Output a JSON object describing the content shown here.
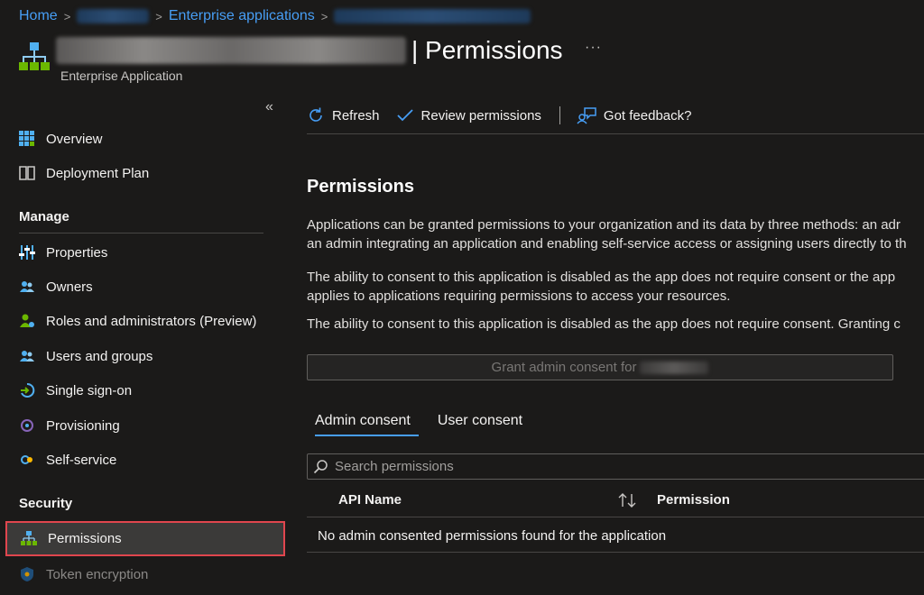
{
  "breadcrumb": {
    "home": "Home",
    "enterprise_apps": "Enterprise applications"
  },
  "header": {
    "title": "| Permissions",
    "subtitle": "Enterprise Application",
    "more": "···"
  },
  "sidebar": {
    "collapse": "«",
    "items_top": [
      {
        "label": "Overview",
        "icon": "grid-icon"
      },
      {
        "label": "Deployment Plan",
        "icon": "book-icon"
      }
    ],
    "manage_heading": "Manage",
    "manage_items": [
      {
        "label": "Properties",
        "icon": "sliders-icon"
      },
      {
        "label": "Owners",
        "icon": "people-icon"
      },
      {
        "label": "Roles and administrators (Preview)",
        "icon": "person-badge-icon"
      },
      {
        "label": "Users and groups",
        "icon": "people-icon"
      },
      {
        "label": "Single sign-on",
        "icon": "sign-in-icon"
      },
      {
        "label": "Provisioning",
        "icon": "cloud-sync-icon"
      },
      {
        "label": "Self-service",
        "icon": "self-service-icon"
      }
    ],
    "security_heading": "Security",
    "security_items": [
      {
        "label": "Permissions",
        "icon": "hierarchy-icon",
        "active": true
      },
      {
        "label": "Token encryption",
        "icon": "shield-icon"
      }
    ]
  },
  "toolbar": {
    "refresh": "Refresh",
    "review": "Review permissions",
    "feedback": "Got feedback?"
  },
  "content": {
    "heading": "Permissions",
    "para1_line1": "Applications can be granted permissions to your organization and its data by three methods: an adr",
    "para1_line2": "an admin integrating an application and enabling self-service access or assigning users directly to th",
    "para2_line1": "The ability to consent to this application is disabled as the app does not require consent or the app",
    "para2_line2": "applies to applications requiring permissions to access your resources.",
    "para3": "The ability to consent to this application is disabled as the app does not require consent. Granting c",
    "grant_button": "Grant admin consent for"
  },
  "tabs": [
    "Admin consent",
    "User consent"
  ],
  "search": {
    "placeholder": "Search permissions"
  },
  "table": {
    "columns": [
      "API Name",
      "Permission"
    ],
    "empty_message": "No admin consented permissions found for the application"
  },
  "colors": {
    "accent": "#479ef5",
    "active_border": "#e0464e",
    "background": "#1b1a19"
  }
}
